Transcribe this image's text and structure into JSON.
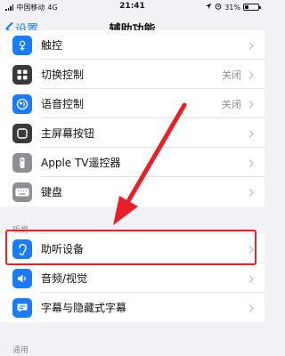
{
  "status": {
    "carrier": "中国移动",
    "network": "4G",
    "time": "21:41",
    "battery": "31%",
    "battery_level": 0.31
  },
  "nav": {
    "back_label": "设置",
    "title": "辅助功能"
  },
  "groups": {
    "physical": [
      {
        "label": "触控",
        "value": ""
      },
      {
        "label": "切换控制",
        "value": "关闭"
      },
      {
        "label": "语音控制",
        "value": "关闭"
      },
      {
        "label": "主屏幕按钮",
        "value": ""
      },
      {
        "label": "Apple TV遥控器",
        "value": ""
      },
      {
        "label": "键盘",
        "value": ""
      }
    ],
    "hearing_header": "听觉",
    "hearing": [
      {
        "label": "助听设备",
        "value": ""
      },
      {
        "label": "音频/视觉",
        "value": ""
      },
      {
        "label": "字幕与隐藏式字幕",
        "value": ""
      }
    ],
    "general_header": "通用"
  },
  "colors": {
    "accent": "#1a7bff",
    "annotation": "#e8202a",
    "icon_blue": "#1a7bff",
    "icon_dark": "#3a3a3c"
  },
  "icons": [
    "touch-icon",
    "switch-control-icon",
    "voice-control-icon",
    "home-button-icon",
    "apple-tv-remote-icon",
    "keyboard-icon",
    "hearing-devices-icon",
    "audio-visual-icon",
    "subtitles-icon"
  ]
}
